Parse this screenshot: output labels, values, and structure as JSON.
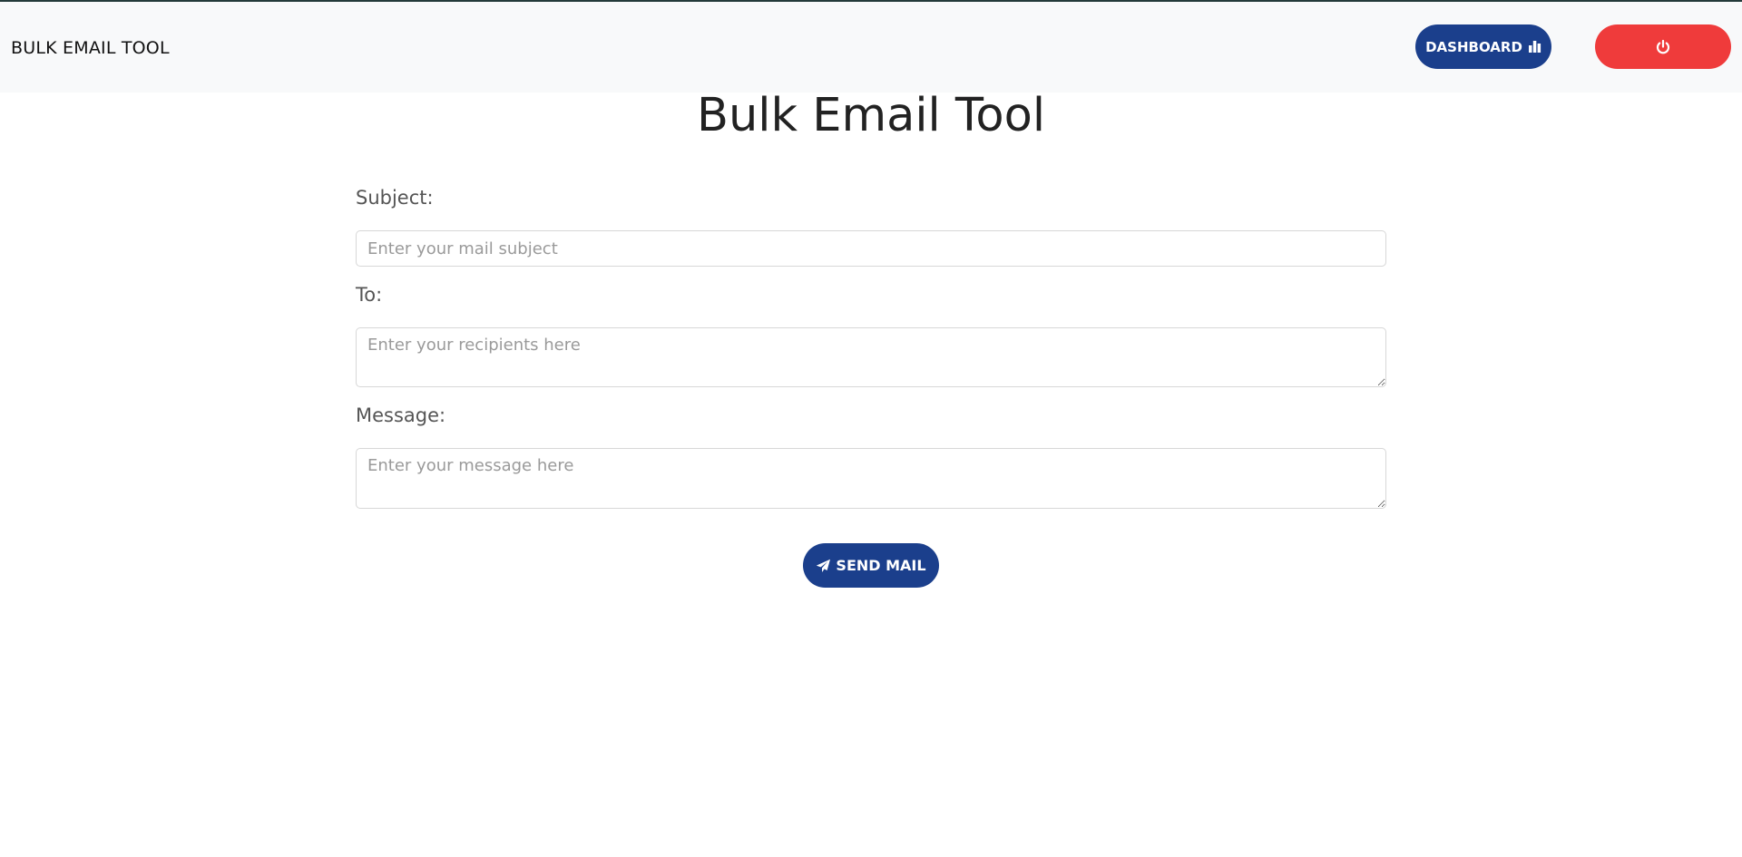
{
  "header": {
    "brand": "BULK EMAIL TOOL",
    "dashboard_label": "DASHBOARD",
    "dashboard_icon": "bar-chart-icon",
    "logout_icon": "power-icon"
  },
  "page": {
    "title": "Bulk Email Tool"
  },
  "form": {
    "subject_label": "Subject:",
    "subject_placeholder": "Enter your mail subject",
    "subject_value": "",
    "to_label": "To:",
    "to_placeholder": "Enter your recipients here",
    "to_value": "",
    "message_label": "Message:",
    "message_placeholder": "Enter your message here",
    "message_value": "",
    "send_label": "SEND MAIL",
    "send_icon": "paper-plane-icon"
  },
  "colors": {
    "primary": "#1b3f8c",
    "danger": "#ef3b3b",
    "navbar_bg": "#f8f9fa"
  }
}
